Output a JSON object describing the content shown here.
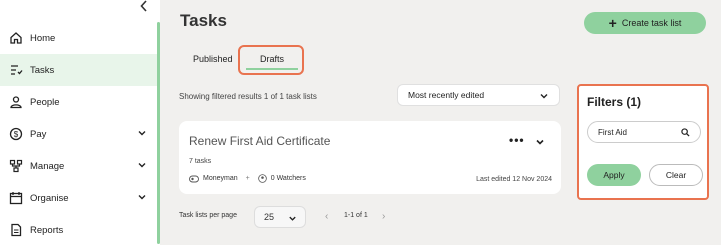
{
  "sidebar": {
    "collapse_icon": "chevron-left-icon",
    "items": [
      {
        "label": "Home",
        "icon": "home-icon"
      },
      {
        "label": "Tasks",
        "icon": "tasks-icon",
        "active": true
      },
      {
        "label": "People",
        "icon": "person-icon"
      },
      {
        "label": "Pay",
        "icon": "dollar-icon",
        "expandable": true
      },
      {
        "label": "Manage",
        "icon": "org-chart-icon",
        "expandable": true
      },
      {
        "label": "Organise",
        "icon": "calendar-icon",
        "expandable": true
      },
      {
        "label": "Reports",
        "icon": "document-icon"
      }
    ],
    "accent_color": "#8fd19e"
  },
  "header": {
    "title": "Tasks",
    "create_label": "Create task list"
  },
  "tabs": [
    {
      "label": "Published"
    },
    {
      "label": "Drafts",
      "selected": true
    }
  ],
  "results": {
    "summary": "Showing filtered results 1 of 1 task lists",
    "sort_value": "Most recently edited"
  },
  "task_lists": [
    {
      "title": "Renew First Aid Certificate",
      "tasks": "7 tasks",
      "owner": "Moneyman",
      "separator": "+",
      "watchers": "0 Watchers",
      "edited": "Last edited 12 Nov 2024"
    }
  ],
  "pagination": {
    "per_page_label": "Task lists per page",
    "per_page_value": "25",
    "range": "1-1 of 1",
    "prev": "‹",
    "next": "›"
  },
  "filters": {
    "title": "Filters (1)",
    "search_value": "First Aid",
    "apply_label": "Apply",
    "clear_label": "Clear"
  },
  "colors": {
    "highlight": "#e9734f",
    "background": "#f1f0ee"
  }
}
